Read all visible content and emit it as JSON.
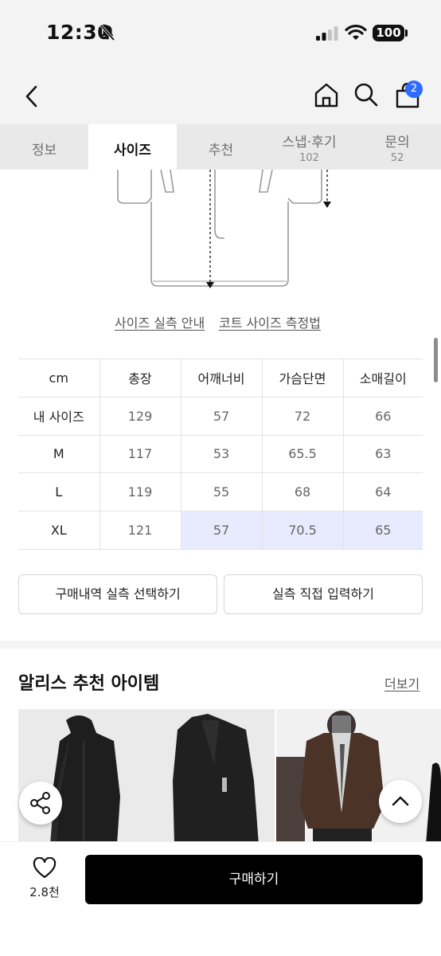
{
  "status_bar": {
    "time": "12:30",
    "battery": "100"
  },
  "header": {
    "cart_count": "2"
  },
  "tabs": [
    {
      "label": "정보",
      "count": ""
    },
    {
      "label": "사이즈",
      "count": ""
    },
    {
      "label": "추천",
      "count": ""
    },
    {
      "label": "스냅·후기",
      "count": "102"
    },
    {
      "label": "문의",
      "count": "52"
    }
  ],
  "active_tab": "사이즈",
  "size_links": {
    "guide": "사이즈 실측 안내",
    "measure": "코트 사이즈 측정법"
  },
  "size_table": {
    "headers": [
      "cm",
      "총장",
      "어깨너비",
      "가슴단면",
      "소매길이"
    ],
    "rows": [
      [
        "내 사이즈",
        "129",
        "57",
        "72",
        "66"
      ],
      [
        "M",
        "117",
        "53",
        "65.5",
        "63"
      ],
      [
        "L",
        "119",
        "55",
        "68",
        "64"
      ],
      [
        "XL",
        "121",
        "57",
        "70.5",
        "65"
      ]
    ]
  },
  "buttons": {
    "select_history": "구매내역 실측 선택하기",
    "enter_direct": "실측 직접 입력하기"
  },
  "recommend": {
    "title": "알리스 추천 아이템",
    "more": "더보기"
  },
  "bottom": {
    "likes": "2.8천",
    "buy": "구매하기"
  },
  "colors": {
    "accent_blue": "#2e6bff",
    "highlight": "#e8ebfd",
    "buy_button": "#000000"
  }
}
